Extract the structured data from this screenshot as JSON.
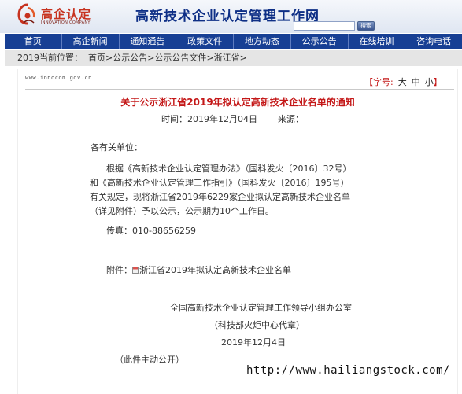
{
  "header": {
    "logo_name": "高企认定",
    "logo_sub": "INNOVATION COMPANY",
    "site_title": "高新技术企业认定管理工作网",
    "search_placeholder": "",
    "search_button": "搜索"
  },
  "nav": {
    "items": [
      "首页",
      "高企新闻",
      "通知通告",
      "政策文件",
      "地方动态",
      "公示公告",
      "在线培训",
      "咨询电话"
    ]
  },
  "breadcrumb": {
    "date_location": "2019当前位置：",
    "home": "首页",
    "sep1": ">",
    "level1": "公示公告",
    "sep2": ">",
    "level2": "公示公告文件",
    "sep3": ">",
    "level3": "浙江省",
    "sep4": ">"
  },
  "article": {
    "domain": "www.innocom.gov.cn",
    "font_size_label": "【字号:",
    "font_size_options": [
      "大",
      "中",
      "小"
    ],
    "font_size_close": "】",
    "title": "关于公示浙江省2019年拟认定高新技术企业名单的通知",
    "time_label": "时间：2019年12月04日",
    "source_label": "来源：",
    "greeting": "各有关单位：",
    "body_lines": [
      "根据《高新技术企业认定管理办法》（国科发火〔2016〕32号）",
      "和《高新技术企业认定管理工作指引》（国科发火〔2016〕195号）",
      "有关规定，现将浙江省2019年6229家企业拟认定高新技术企业名单",
      "（详见附件）予以公示，公示期为10个工作日。"
    ],
    "fax": "传真：010-88656259",
    "attachment_label": "附件：",
    "attachment_link": "浙江省2019年拟认定高新技术企业名单",
    "signature_org": "全国高新技术企业认定管理工作领导小组办公室",
    "signature_sub": "（科技部火炬中心代章）",
    "signature_date": "2019年12月4日",
    "public_note": "（此件主动公开）"
  },
  "watermark": "http://www.hailiangstock.com/",
  "colors": {
    "nav_bg": "#173f94",
    "title_red": "#c41818",
    "site_title_blue": "#0e2f86",
    "crumb_bg": "#e5e5e5"
  }
}
